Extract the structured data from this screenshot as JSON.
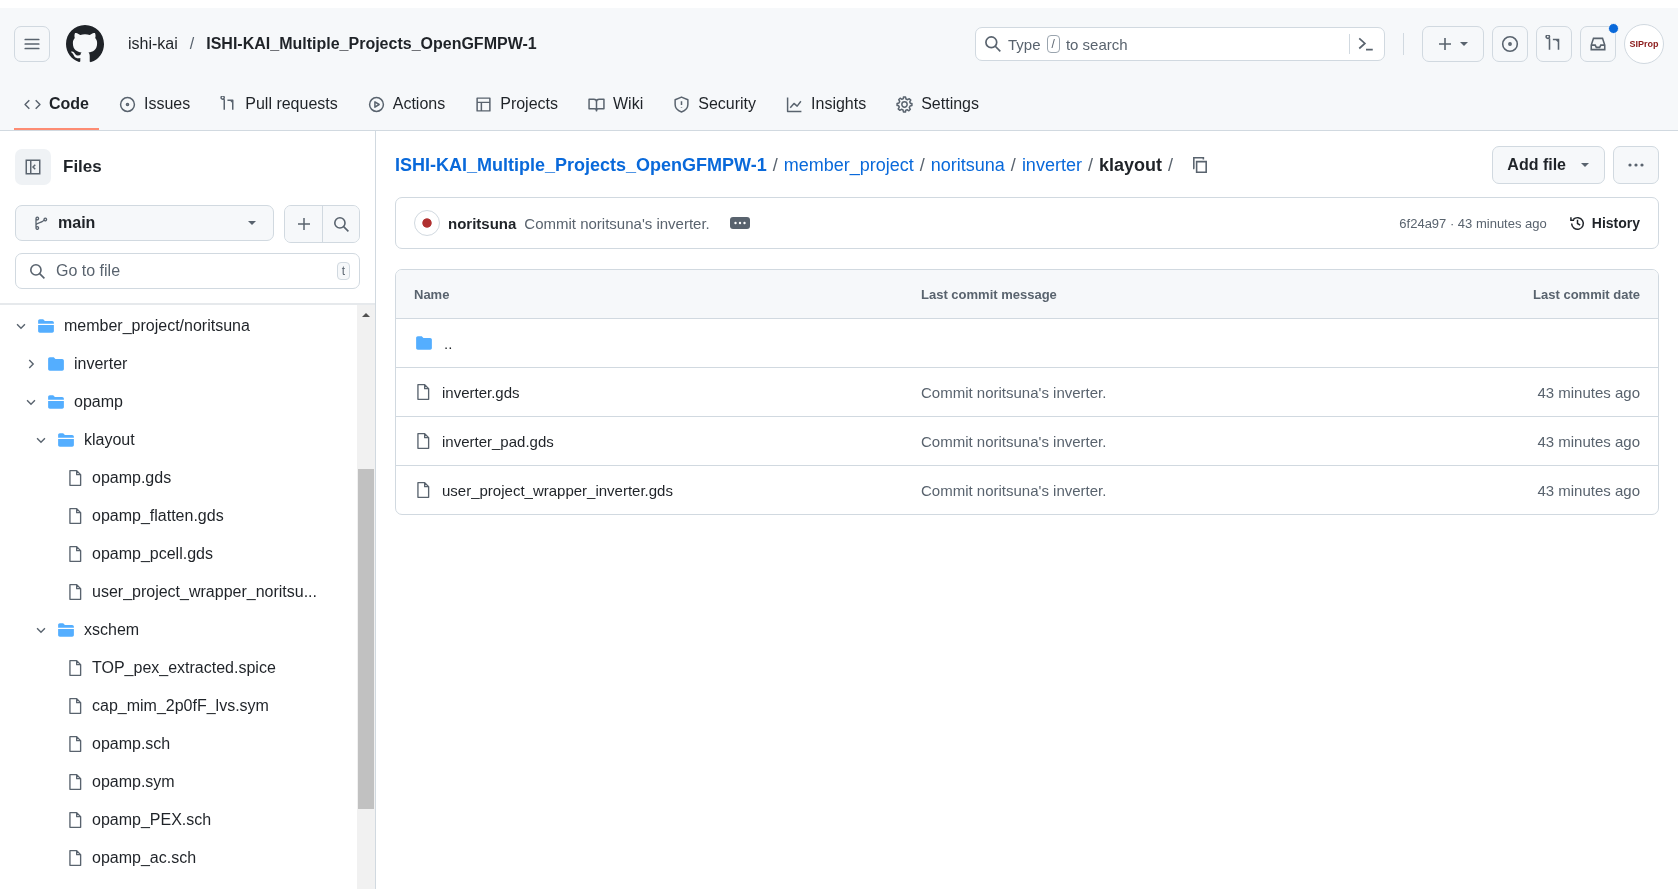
{
  "header": {
    "owner": "ishi-kai",
    "separator": "/",
    "repo": "ISHI-KAI_Multiple_Projects_OpenGFMPW-1",
    "search": {
      "placeholder_before": "Type",
      "key": "/",
      "placeholder_after": "to search"
    },
    "avatar_text": "SIProp",
    "inbox_unread": true
  },
  "tabs": [
    {
      "label": "Code",
      "selected": true
    },
    {
      "label": "Issues",
      "selected": false
    },
    {
      "label": "Pull requests",
      "selected": false
    },
    {
      "label": "Actions",
      "selected": false
    },
    {
      "label": "Projects",
      "selected": false
    },
    {
      "label": "Wiki",
      "selected": false
    },
    {
      "label": "Security",
      "selected": false
    },
    {
      "label": "Insights",
      "selected": false
    },
    {
      "label": "Settings",
      "selected": false
    }
  ],
  "sidebar": {
    "title": "Files",
    "branch": "main",
    "search": {
      "placeholder": "Go to file",
      "shortcut": "t"
    },
    "tree": [
      {
        "kind": "folder",
        "name": "member_project/noritsuna",
        "expanded": true,
        "children": [
          {
            "kind": "folder",
            "name": "inverter",
            "expanded": false
          },
          {
            "kind": "folder",
            "name": "opamp",
            "expanded": true,
            "children": [
              {
                "kind": "folder",
                "name": "klayout",
                "expanded": true,
                "children": [
                  {
                    "kind": "file",
                    "name": "opamp.gds"
                  },
                  {
                    "kind": "file",
                    "name": "opamp_flatten.gds"
                  },
                  {
                    "kind": "file",
                    "name": "opamp_pcell.gds"
                  },
                  {
                    "kind": "file",
                    "name": "user_project_wrapper_noritsu..."
                  }
                ]
              },
              {
                "kind": "folder",
                "name": "xschem",
                "expanded": true,
                "children": [
                  {
                    "kind": "file",
                    "name": "TOP_pex_extracted.spice"
                  },
                  {
                    "kind": "file",
                    "name": "cap_mim_2p0fF_lvs.sym"
                  },
                  {
                    "kind": "file",
                    "name": "opamp.sch"
                  },
                  {
                    "kind": "file",
                    "name": "opamp.sym"
                  },
                  {
                    "kind": "file",
                    "name": "opamp_PEX.sch"
                  },
                  {
                    "kind": "file",
                    "name": "opamp_ac.sch"
                  }
                ]
              }
            ]
          }
        ]
      }
    ]
  },
  "breadcrumb": {
    "links": [
      "ISHI-KAI_Multiple_Projects_OpenGFMPW-1",
      "member_project",
      "noritsuna",
      "inverter"
    ],
    "current": "klayout",
    "separator": "/"
  },
  "add_file": "Add file",
  "commit": {
    "author": "noritsuna",
    "message": "Commit noritsuna's inverter.",
    "sha_time": "6f24a97 · 43 minutes ago",
    "history": "History"
  },
  "table": {
    "columns": [
      "Name",
      "Last commit message",
      "Last commit date"
    ],
    "rows": [
      {
        "kind": "parent",
        "name": "..",
        "message": "",
        "date": ""
      },
      {
        "kind": "file",
        "name": "inverter.gds",
        "message": "Commit noritsuna's inverter.",
        "date": "43 minutes ago"
      },
      {
        "kind": "file",
        "name": "inverter_pad.gds",
        "message": "Commit noritsuna's inverter.",
        "date": "43 minutes ago"
      },
      {
        "kind": "file",
        "name": "user_project_wrapper_inverter.gds",
        "message": "Commit noritsuna's inverter.",
        "date": "43 minutes ago"
      }
    ]
  }
}
